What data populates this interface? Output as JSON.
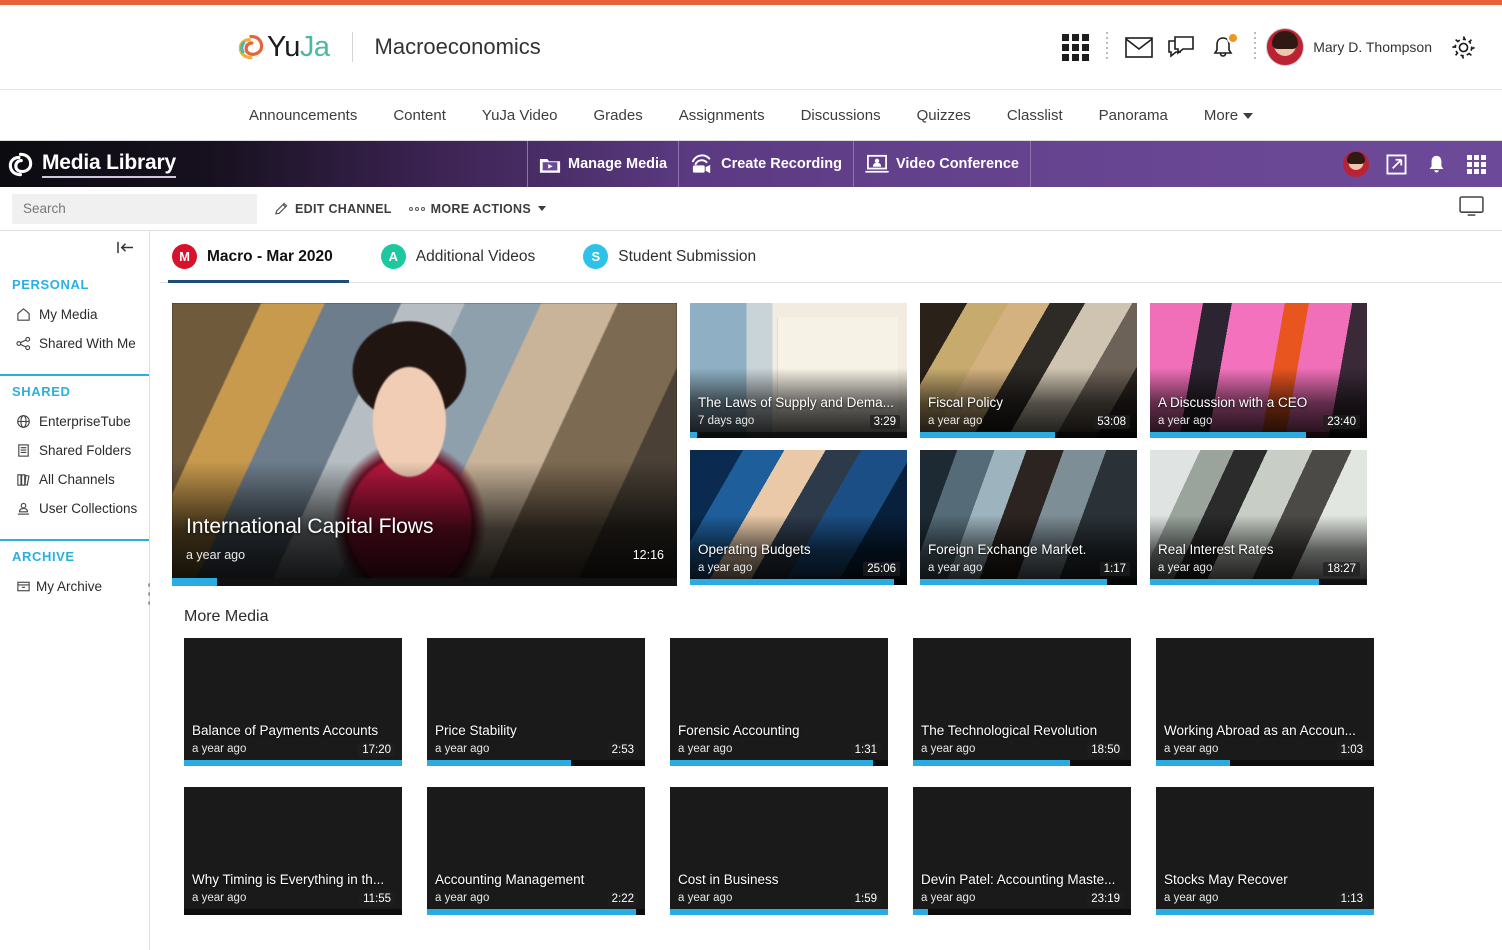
{
  "header": {
    "brand": "YuJa",
    "brand_yu": "Yu",
    "brand_ja": "Ja",
    "course_title": "Macroeconomics",
    "username": "Mary D. Thompson"
  },
  "course_nav": {
    "items": [
      "Announcements",
      "Content",
      "YuJa Video",
      "Grades",
      "Assignments",
      "Discussions",
      "Quizzes",
      "Classlist",
      "Panorama",
      "More"
    ]
  },
  "media_bar": {
    "title": "Media Library",
    "buttons": [
      "Manage Media",
      "Create Recording",
      "Video Conference"
    ]
  },
  "action_row": {
    "search_placeholder": "Search",
    "edit_channel": "EDIT CHANNEL",
    "more_actions": "MORE ACTIONS"
  },
  "sidebar": {
    "groups": [
      {
        "heading": "PERSONAL",
        "items": [
          {
            "label": "My Media",
            "icon": "home-icon"
          },
          {
            "label": "Shared With Me",
            "icon": "share-icon"
          }
        ]
      },
      {
        "heading": "SHARED",
        "items": [
          {
            "label": "EnterpriseTube",
            "icon": "globe-icon"
          },
          {
            "label": "Shared Folders",
            "icon": "folder-icon"
          },
          {
            "label": "All Channels",
            "icon": "books-icon"
          },
          {
            "label": "User Collections",
            "icon": "user-collection-icon"
          }
        ]
      },
      {
        "heading": "ARCHIVE",
        "items": [
          {
            "label": "My Archive",
            "icon": "archive-icon"
          }
        ]
      }
    ]
  },
  "tabs": [
    {
      "badge": "M",
      "label": "Macro - Mar 2020",
      "color": "#d8122a",
      "active": true
    },
    {
      "badge": "A",
      "label": "Additional Videos",
      "color": "#1bc8a0",
      "active": false
    },
    {
      "badge": "S",
      "label": "Student Submission",
      "color": "#2ec2e6",
      "active": false
    }
  ],
  "featured": {
    "title": "International Capital Flows",
    "date": "a year ago",
    "duration": "12:16",
    "progress_pct": 9
  },
  "top_cards": [
    {
      "title": "The Laws of Supply and Dema...",
      "date": "7 days ago",
      "duration": "3:29",
      "progress_pct": 3,
      "art": "art-supply"
    },
    {
      "title": "Fiscal Policy",
      "date": "a year ago",
      "duration": "53:08",
      "progress_pct": 62,
      "art": "art-fiscal"
    },
    {
      "title": "A Discussion with a CEO",
      "date": "a year ago",
      "duration": "23:40",
      "progress_pct": 72,
      "art": "art-ceo"
    },
    {
      "title": "Operating Budgets",
      "date": "a year ago",
      "duration": "25:06",
      "progress_pct": 94,
      "art": "art-oper"
    },
    {
      "title": "Foreign Exchange Market.",
      "date": "a year ago",
      "duration": "1:17",
      "progress_pct": 86,
      "art": "art-forex"
    },
    {
      "title": "Real Interest Rates",
      "date": "a year ago",
      "duration": "18:27",
      "progress_pct": 78,
      "art": "art-real"
    }
  ],
  "more_media": {
    "heading": "More Media",
    "cards": [
      {
        "title": "Balance of Payments Accounts",
        "date": "a year ago",
        "duration": "17:20",
        "progress_pct": 100,
        "art": "art-bop"
      },
      {
        "title": "Price Stability",
        "date": "a year ago",
        "duration": "2:53",
        "progress_pct": 66,
        "art": "art-price"
      },
      {
        "title": "Forensic Accounting",
        "date": "a year ago",
        "duration": "1:31",
        "progress_pct": 93,
        "art": "art-forensic"
      },
      {
        "title": "The Technological Revolution",
        "date": "a year ago",
        "duration": "18:50",
        "progress_pct": 72,
        "art": "art-tech"
      },
      {
        "title": "Working Abroad as an Accoun...",
        "date": "a year ago",
        "duration": "1:03",
        "progress_pct": 34,
        "art": "art-work"
      },
      {
        "title": "Why Timing is Everything in th...",
        "date": "a year ago",
        "duration": "11:55",
        "progress_pct": 0,
        "art": "art-timing"
      },
      {
        "title": "Accounting Management",
        "date": "a year ago",
        "duration": "2:22",
        "progress_pct": 96,
        "art": "art-acctmgmt"
      },
      {
        "title": "Cost in Business",
        "date": "a year ago",
        "duration": "1:59",
        "progress_pct": 100,
        "art": "art-cost"
      },
      {
        "title": "Devin Patel: Accounting Maste...",
        "date": "a year ago",
        "duration": "23:19",
        "progress_pct": 7,
        "art": "art-devin"
      },
      {
        "title": "Stocks May Recover",
        "date": "a year ago",
        "duration": "1:13",
        "progress_pct": 100,
        "art": "art-stocks"
      }
    ]
  },
  "colors": {
    "accent_orange": "#e8633a",
    "sidebar_heading": "#2ab0e0",
    "progress": "#2aace2",
    "tab_underline": "#1a4e78",
    "purple": "#6d4a99"
  }
}
